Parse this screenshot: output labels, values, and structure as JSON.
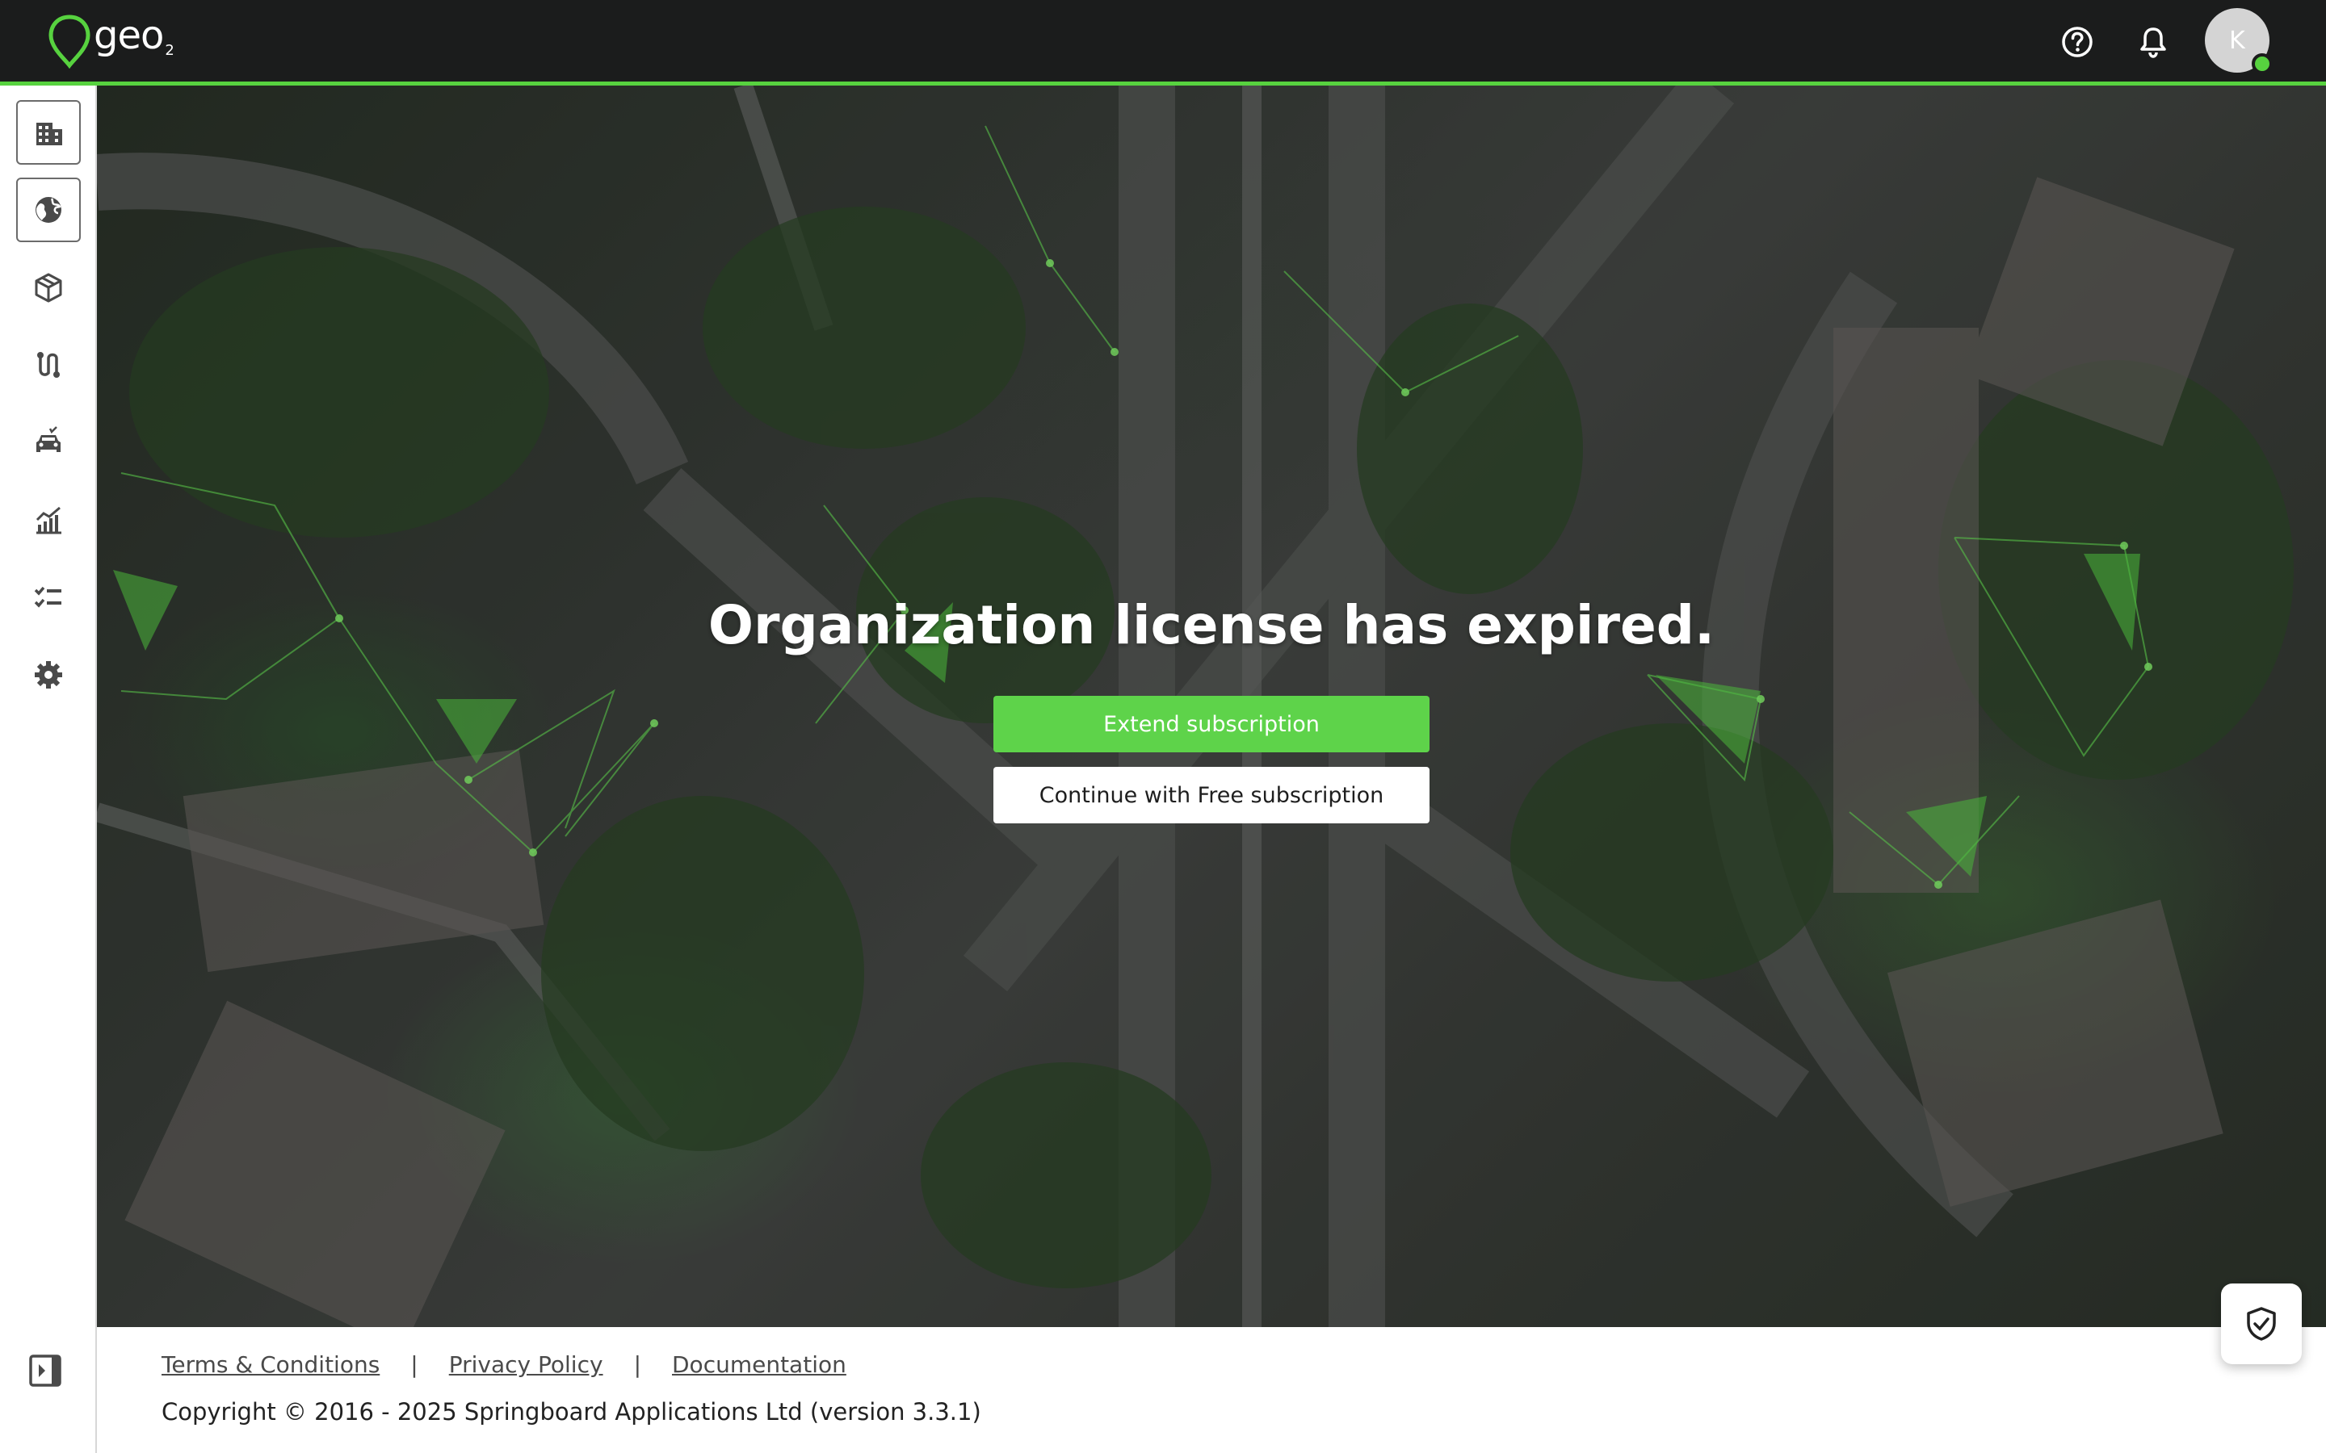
{
  "app": {
    "logo_text": "geo",
    "logo_sub": "2",
    "brand_color": "#57d23f"
  },
  "header": {
    "icons": [
      "help-circle-icon",
      "bell-icon"
    ],
    "avatar_initial": "K",
    "avatar_status": "online"
  },
  "sidebar": {
    "items": [
      {
        "name": "organization",
        "icon": "building-icon"
      },
      {
        "name": "maps",
        "icon": "globe-icon"
      },
      {
        "name": "assets",
        "icon": "cube-icon"
      },
      {
        "name": "routes",
        "icon": "route-icon"
      },
      {
        "name": "vehicles",
        "icon": "car-icon"
      },
      {
        "name": "analytics",
        "icon": "chart-icon"
      },
      {
        "name": "tasks",
        "icon": "checklist-icon"
      },
      {
        "name": "settings",
        "icon": "gear-icon"
      }
    ],
    "collapse_icon": "sidebar-collapse-icon"
  },
  "main": {
    "title": "Organization license has expired.",
    "extend_button": "Extend subscription",
    "free_button": "Continue with Free subscription"
  },
  "footer": {
    "links": [
      "Terms & Conditions",
      "Privacy Policy",
      "Documentation"
    ],
    "separator": "|",
    "copyright": "Copyright © 2016 - 2025 Springboard Applications Ltd (version 3.3.1)"
  },
  "floating": {
    "icon": "shield-check-icon"
  }
}
